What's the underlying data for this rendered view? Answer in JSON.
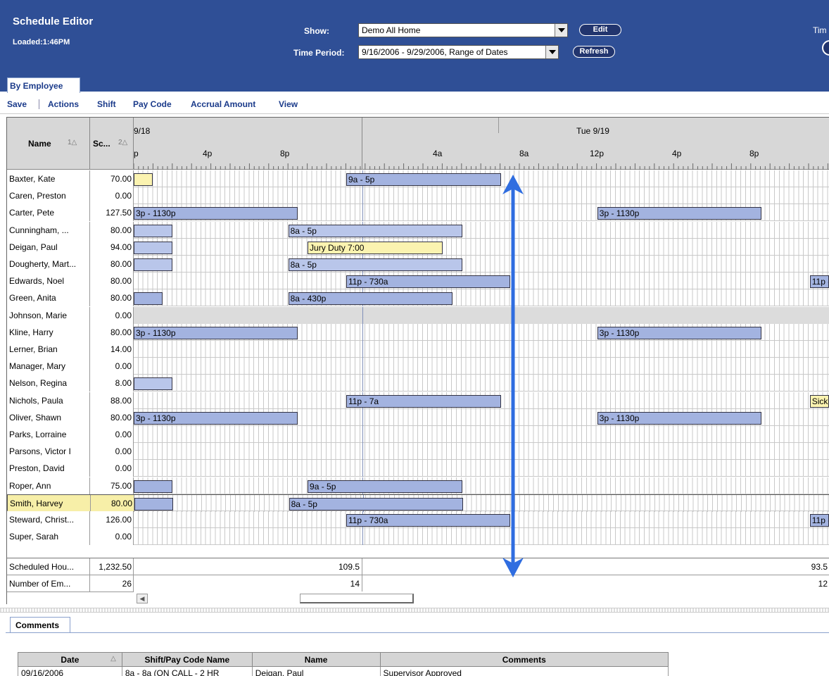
{
  "header": {
    "title": "Schedule Editor",
    "loaded": "Loaded:1:46PM",
    "show_label": "Show:",
    "show_value": "Demo All Home",
    "edit_label": "Edit",
    "period_label": "Time Period:",
    "period_value": "9/16/2006 - 9/29/2006, Range of Dates",
    "refresh_label": "Refresh",
    "tim_label": "Tim"
  },
  "tabs": {
    "by_employee": "By Employee"
  },
  "menu": {
    "save": "Save",
    "actions": "Actions",
    "shift": "Shift",
    "pay_code": "Pay Code",
    "accrual_amount": "Accrual Amount",
    "view": "View"
  },
  "grid": {
    "col_name": "Name",
    "col_name_sort": "1",
    "col_sched": "Sc...",
    "col_sched_sort": "2",
    "day1_label": "9/18",
    "day2_label": "Tue 9/19",
    "ticks": [
      "p",
      "4p",
      "8p",
      "4a",
      "8a",
      "12p",
      "4p",
      "8p"
    ],
    "rows": [
      {
        "name": "Baxter, Kate",
        "hours": "70.00",
        "bars": [
          {
            "cls": "yl",
            "s": 0,
            "e": 1,
            "label": ""
          },
          {
            "cls": "",
            "s": 11,
            "e": 19,
            "label": "9a - 5p"
          }
        ]
      },
      {
        "name": "Caren, Preston",
        "hours": "0.00",
        "bars": []
      },
      {
        "name": "Carter, Pete",
        "hours": "127.50",
        "bars": [
          {
            "cls": "",
            "s": 0,
            "e": 8.5,
            "label": "3p - 1130p"
          },
          {
            "cls": "",
            "s": 24,
            "e": 32.5,
            "label": "3p - 1130p"
          }
        ]
      },
      {
        "name": "Cunningham, ...",
        "hours": "80.00",
        "bars": [
          {
            "cls": "lt",
            "s": 0,
            "e": 2,
            "label": ""
          },
          {
            "cls": "lt",
            "s": 8,
            "e": 17,
            "label": "8a - 5p"
          }
        ]
      },
      {
        "name": "Deigan, Paul",
        "hours": "94.00",
        "bars": [
          {
            "cls": "lt",
            "s": 0,
            "e": 2,
            "label": ""
          },
          {
            "cls": "yl",
            "s": 9,
            "e": 16,
            "label": "Jury Duty 7:00"
          }
        ]
      },
      {
        "name": "Dougherty, Mart...",
        "hours": "80.00",
        "bars": [
          {
            "cls": "lt",
            "s": 0,
            "e": 2,
            "label": ""
          },
          {
            "cls": "lt",
            "s": 8,
            "e": 17,
            "label": "8a - 5p"
          }
        ]
      },
      {
        "name": "Edwards, Noel",
        "hours": "80.00",
        "bars": [
          {
            "cls": "",
            "s": 11,
            "e": 19.5,
            "label": "11p - 730a"
          },
          {
            "cls": "",
            "s": 35,
            "e": 36,
            "label": "11p - "
          }
        ]
      },
      {
        "name": "Green, Anita",
        "hours": "80.00",
        "bars": [
          {
            "cls": "",
            "s": 0,
            "e": 1.5,
            "label": ""
          },
          {
            "cls": "",
            "s": 8,
            "e": 16.5,
            "label": "8a - 430p"
          }
        ]
      },
      {
        "name": "Johnson, Marie",
        "hours": "0.00",
        "bars": [],
        "dim": true
      },
      {
        "name": "Kline, Harry",
        "hours": "80.00",
        "bars": [
          {
            "cls": "",
            "s": 0,
            "e": 8.5,
            "label": "3p - 1130p"
          },
          {
            "cls": "",
            "s": 24,
            "e": 32.5,
            "label": "3p - 1130p"
          }
        ]
      },
      {
        "name": "Lerner, Brian",
        "hours": "14.00",
        "bars": []
      },
      {
        "name": "Manager, Mary",
        "hours": "0.00",
        "bars": []
      },
      {
        "name": "Nelson, Regina",
        "hours": "8.00",
        "bars": [
          {
            "cls": "lt",
            "s": 0,
            "e": 2,
            "label": ""
          }
        ]
      },
      {
        "name": "Nichols, Paula",
        "hours": "88.00",
        "bars": [
          {
            "cls": "",
            "s": 11,
            "e": 19,
            "label": "11p - 7a"
          },
          {
            "cls": "yl",
            "s": 35,
            "e": 36,
            "label": "Sick"
          }
        ]
      },
      {
        "name": "Oliver, Shawn",
        "hours": "80.00",
        "bars": [
          {
            "cls": "",
            "s": 0,
            "e": 8.5,
            "label": "3p - 1130p"
          },
          {
            "cls": "",
            "s": 24,
            "e": 32.5,
            "label": "3p - 1130p"
          }
        ]
      },
      {
        "name": "Parks, Lorraine",
        "hours": "0.00",
        "bars": []
      },
      {
        "name": "Parsons, Victor I",
        "hours": "0.00",
        "bars": []
      },
      {
        "name": "Preston, David",
        "hours": "0.00",
        "bars": []
      },
      {
        "name": "Roper, Ann",
        "hours": "75.00",
        "bars": [
          {
            "cls": "",
            "s": 0,
            "e": 2,
            "label": ""
          },
          {
            "cls": "",
            "s": 9,
            "e": 17,
            "label": "9a - 5p"
          }
        ]
      },
      {
        "name": "Smith, Harvey",
        "hours": "80.00",
        "bars": [
          {
            "cls": "",
            "s": 0,
            "e": 2,
            "label": ""
          },
          {
            "cls": "",
            "s": 8,
            "e": 17,
            "label": "8a - 5p"
          }
        ],
        "selected": true
      },
      {
        "name": "Steward, Christ...",
        "hours": "126.00",
        "bars": [
          {
            "cls": "",
            "s": 11,
            "e": 19.5,
            "label": "11p - 730a"
          },
          {
            "cls": "",
            "s": 35,
            "e": 36,
            "label": "11p - "
          }
        ]
      },
      {
        "name": "Super, Sarah",
        "hours": "0.00",
        "bars": []
      }
    ],
    "totals": [
      {
        "label": "Scheduled Hou...",
        "value": "1,232.50",
        "day1": "109.5",
        "day2": "93.5"
      },
      {
        "label": "Number of Em...",
        "value": "26",
        "day1": "14",
        "day2": "12"
      }
    ]
  },
  "comments": {
    "tab": "Comments",
    "headers": [
      "Date",
      "Shift/Pay Code Name",
      "Name",
      "Comments"
    ],
    "rows": [
      [
        "09/16/2006",
        "8a - 8a (ON CALL - 2 HR",
        "Deigan, Paul",
        "Supervisor Approved"
      ]
    ]
  },
  "colors": {
    "header_bg": "#2f4f96",
    "shift_bar": "#a3b3e0",
    "paycode_bar": "#fbf3b0",
    "selected_row": "#f7efa8",
    "arrow": "#2f6de0"
  }
}
